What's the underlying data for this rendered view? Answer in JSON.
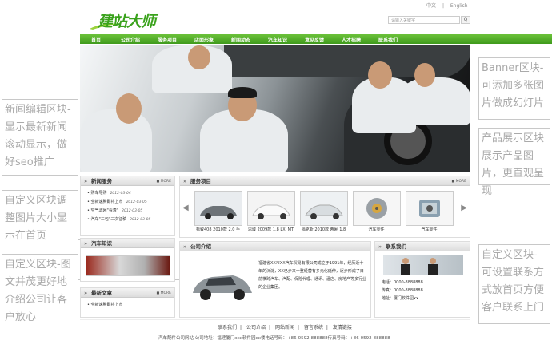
{
  "header": {
    "lang_cn": "中文",
    "lang_sep": "|",
    "lang_en": "English",
    "logo_text": "建站大师",
    "search_placeholder": "请输入关键字",
    "search_button_glyph": "Q"
  },
  "nav": [
    "首页",
    "公司介绍",
    "服务项目",
    "店面形象",
    "新闻动态",
    "汽车知识",
    "意见反馈",
    "人才招聘",
    "联系我们"
  ],
  "annotations": {
    "banner": "Banner区块-可添加多张图片做成幻灯片",
    "news_edit": "新闻编辑区块-显示最新新闻滚动显示，做好seo推广",
    "product": "产品展示区块展示产品图片，更直观呈现",
    "custom_image": "自定义区块调整图片大小显示在首页",
    "custom_text": "自定义区块-图文并茂更好地介绍公司让客户放心",
    "custom_contact": "自定义区块-可设置联系方式放首页方便客户联系上门"
  },
  "news_service": {
    "title": "新闻服务",
    "more": "MORE",
    "items": [
      {
        "text": "购车导购",
        "date": "2012-03-04"
      },
      {
        "text": "全新速腾即将上市",
        "date": "2012-03-05"
      },
      {
        "text": "空气滤网\"看着\"",
        "date": "2012-03-05"
      },
      {
        "text": "汽车\"三包\"二次征稿",
        "date": "2012-03-05"
      }
    ]
  },
  "service_items": {
    "title": "服务项目",
    "more": "MORE",
    "products": [
      {
        "label": "标致408 2010款 2.0 手"
      },
      {
        "label": "思域 2009款 1.8 LXi MT"
      },
      {
        "label": "福克斯 2010款 两厢 1.8"
      },
      {
        "label": "汽车零件"
      },
      {
        "label": "汽车零件"
      }
    ]
  },
  "car_knowledge": {
    "title": "汽车知识"
  },
  "company_intro": {
    "title": "公司介绍",
    "text": "福建省XX市XX汽车贸易有限公司成立于1991年，经历近十年的沉淀，XX已步来一整经营有多元化延伸，逐步形成了目前横跨汽车、汽配、保险代理、通讯、酒店、房地产等多行业的企业集团。"
  },
  "contact_us": {
    "title": "联系我们",
    "phone": "电话：0000-8888888",
    "fax": "传真：0000-8888888",
    "address": "地址：厦门软件园xx"
  },
  "latest_articles": {
    "title": "最新文章",
    "more": "MORE",
    "items": [
      {
        "text": "全新速腾即将上市"
      }
    ]
  },
  "footer": {
    "links": [
      "联系我们",
      "公司介绍",
      "网站新闻",
      "留言系统",
      "友情链接"
    ],
    "sep": "|",
    "info": "汽车配件公司网站 公司地址：福建厦门xxx软件园xx楼电话号码：+86-0592-888888传真号码：+86-0592-888888"
  },
  "colors": {
    "nav_green": "#4fa82a",
    "logo_green": "#3aa21c",
    "annotation_gray": "#aaaaaa"
  }
}
